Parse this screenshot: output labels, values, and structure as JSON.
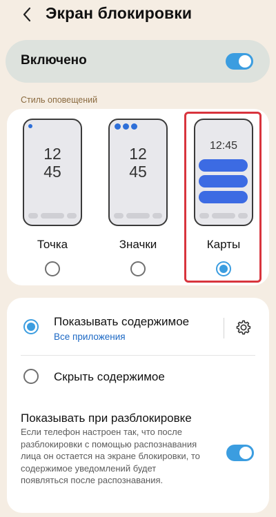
{
  "header": {
    "title": "Экран блокировки",
    "back_icon": "back-arrow-icon"
  },
  "master_switch": {
    "label": "Включено",
    "on": true
  },
  "notification_style": {
    "section_label": "Стиль оповещений",
    "options": [
      {
        "label": "Точка",
        "clock": [
          "12",
          "45"
        ],
        "selected": false
      },
      {
        "label": "Значки",
        "clock": [
          "12",
          "45"
        ],
        "selected": false
      },
      {
        "label": "Карты",
        "clock": "12:45",
        "selected": true
      }
    ]
  },
  "content_options": {
    "show_content": {
      "label": "Показывать содержимое",
      "sublabel": "Все приложения",
      "selected": true,
      "settings_icon": "gear-icon"
    },
    "hide_content": {
      "label": "Скрыть содержимое",
      "selected": false
    },
    "show_on_unlock": {
      "label": "Показывать при разблокировке",
      "description": "Если телефон настроен так, что после разблокировки с помощью распознавания лица он остается на экране блокировки, то содержимое уведомлений будет появляться после распознавания.",
      "on": true
    }
  },
  "colors": {
    "accent": "#3b9de0",
    "background": "#f5ede3",
    "highlight_frame": "#d8343d"
  }
}
